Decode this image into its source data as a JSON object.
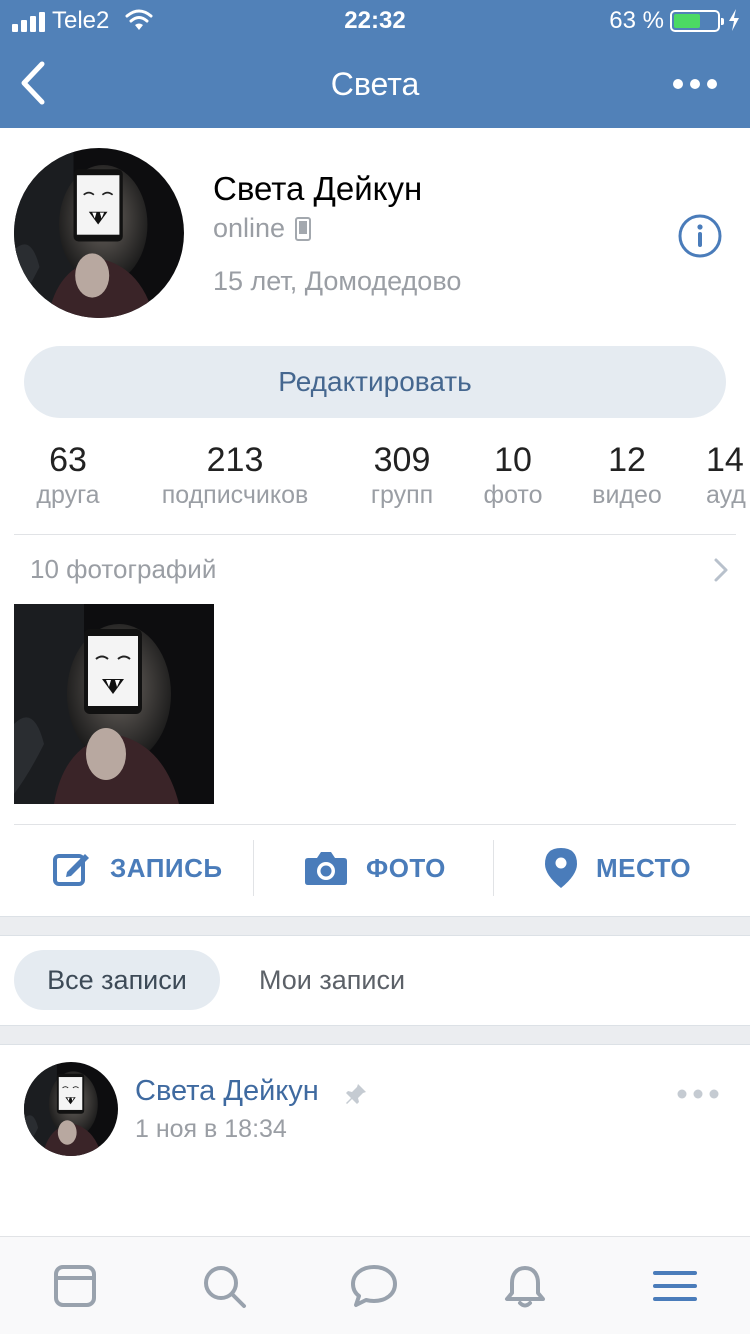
{
  "status_bar": {
    "carrier": "Tele2",
    "time": "22:32",
    "battery_percent": "63 %",
    "battery_level": 0.63,
    "battery_color": "#4cd964"
  },
  "nav": {
    "title": "Света",
    "back_icon": "chevron-left-icon",
    "more_icon": "more-horizontal-icon",
    "background": "#5181b8"
  },
  "profile": {
    "name": "Света Дейкун",
    "status": "online",
    "status_icon": "mobile-phone-icon",
    "details": "15 лет, Домодедово",
    "info_icon": "info-circle-icon",
    "edit_label": "Редактировать"
  },
  "counters": [
    {
      "value": "63",
      "label": "друга"
    },
    {
      "value": "213",
      "label": "подписчиков"
    },
    {
      "value": "309",
      "label": "групп"
    },
    {
      "value": "10",
      "label": "фото"
    },
    {
      "value": "12",
      "label": "видео"
    },
    {
      "value": "14",
      "label": "ауд"
    }
  ],
  "photos": {
    "header": "10 фотографий",
    "chevron_icon": "chevron-right-icon"
  },
  "actions": [
    {
      "label": "ЗАПИСЬ",
      "icon": "edit-note-icon"
    },
    {
      "label": "ФОТО",
      "icon": "camera-icon"
    },
    {
      "label": "МЕСТО",
      "icon": "location-pin-icon"
    }
  ],
  "wall_tabs": {
    "all": "Все записи",
    "mine": "Мои записи"
  },
  "post": {
    "author": "Света Дейкун",
    "date": "1 ноя в 18:34",
    "pin_icon": "pin-icon",
    "more_icon": "more-horizontal-icon"
  },
  "tabbar": [
    {
      "name": "news",
      "icon": "newsfeed-icon"
    },
    {
      "name": "search",
      "icon": "search-icon"
    },
    {
      "name": "messages",
      "icon": "message-bubble-icon"
    },
    {
      "name": "notifications",
      "icon": "bell-icon"
    },
    {
      "name": "menu",
      "icon": "menu-icon"
    }
  ],
  "colors": {
    "accent": "#4a7cba",
    "link": "#3f6aa0",
    "secondary_text": "#9a9ea4",
    "button_bg": "#e5ebf1"
  }
}
